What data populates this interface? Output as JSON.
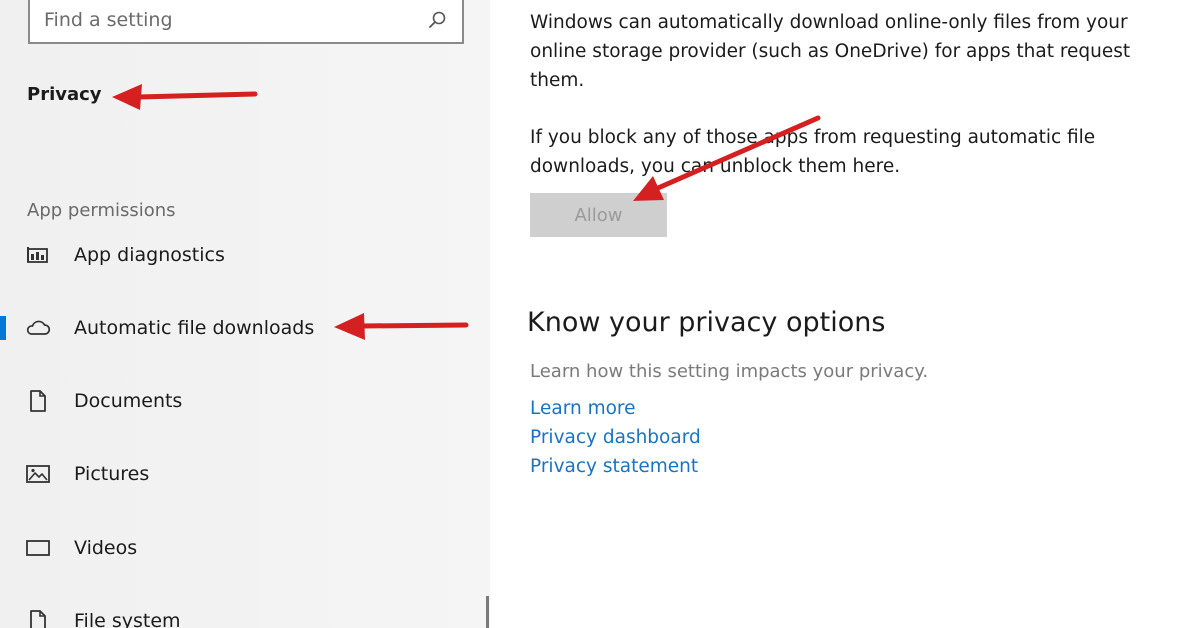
{
  "sidebar": {
    "search": {
      "placeholder": "Find a setting",
      "icon": "search-icon"
    },
    "title": "Privacy",
    "section_label": "App permissions",
    "items": [
      {
        "label": "App diagnostics",
        "icon": "app-diagnostics-icon",
        "selected": false
      },
      {
        "label": "Automatic file downloads",
        "icon": "cloud-icon",
        "selected": true
      },
      {
        "label": "Documents",
        "icon": "document-icon",
        "selected": false
      },
      {
        "label": "Pictures",
        "icon": "pictures-icon",
        "selected": false
      },
      {
        "label": "Videos",
        "icon": "videos-icon",
        "selected": false
      },
      {
        "label": "File system",
        "icon": "file-system-icon",
        "selected": false
      }
    ]
  },
  "main": {
    "paragraph1": "Windows can automatically download online-only files from your online storage provider (such as OneDrive) for apps that request them.",
    "paragraph2": "If you block any of those apps from requesting automatic file downloads, you can unblock them here.",
    "allow_button": {
      "label": "Allow",
      "enabled": false
    },
    "privacy_options": {
      "heading": "Know your privacy options",
      "subtitle": "Learn how this setting impacts your privacy.",
      "links": [
        "Learn more",
        "Privacy dashboard",
        "Privacy statement"
      ]
    }
  },
  "colors": {
    "accent": "#0078d7",
    "link": "#1a73c2",
    "annotation_arrow": "#d42020",
    "disabled_button_bg": "#cfcfcf",
    "disabled_button_text": "#9a9a9a"
  }
}
